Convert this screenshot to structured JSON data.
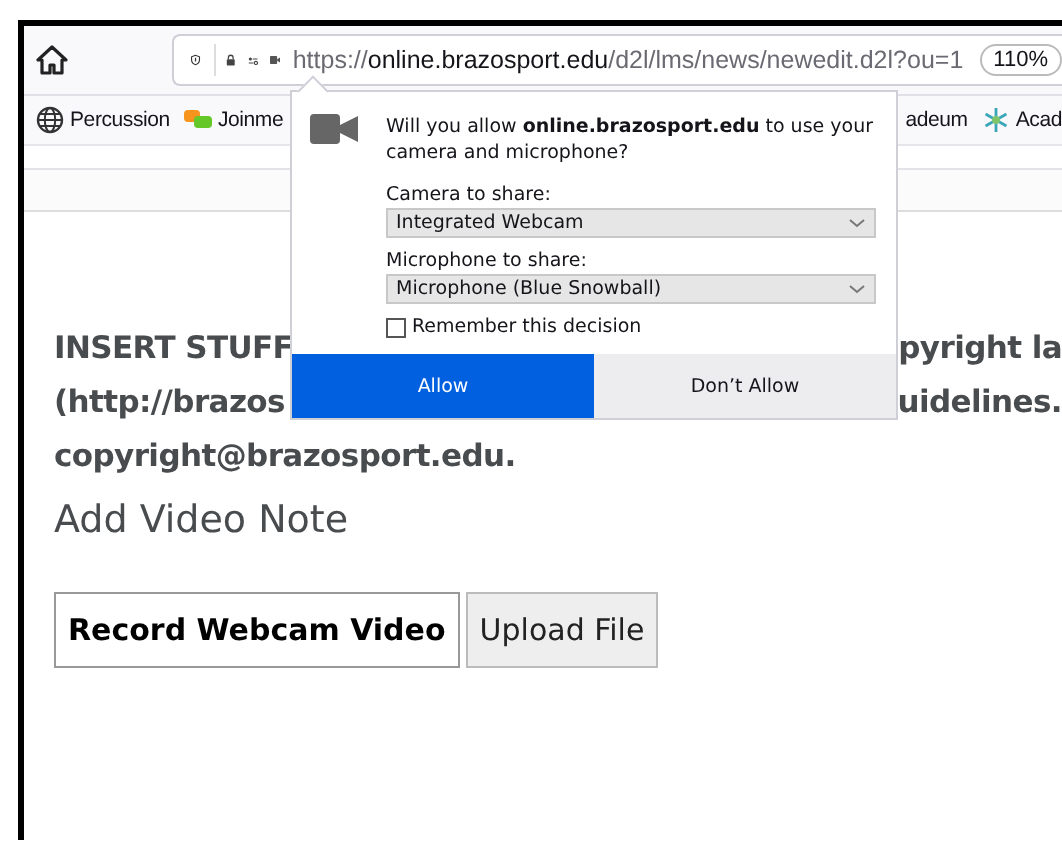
{
  "toolbar": {
    "url": {
      "scheme": "https://",
      "domain": "online.brazosport.edu",
      "path": "/d2l/lms/news/newedit.d2l?ou=1"
    },
    "zoom": "110%"
  },
  "bookmarks": [
    {
      "label": "Percussion",
      "kind": "globe"
    },
    {
      "label": "Joinme",
      "kind": "joinme"
    },
    {
      "label": "adeum",
      "kind": "plain"
    },
    {
      "label": "Acad",
      "kind": "academy"
    }
  ],
  "page": {
    "notice_lines": [
      {
        "left": "INSERT STUFF",
        "right": "pyright la"
      },
      {
        "left": "(http://brazos",
        "right": "uidelines."
      },
      {
        "left": "copyright@brazosport.edu."
      }
    ],
    "heading": "Add Video Note",
    "buttons": [
      {
        "label": "Record Webcam Video",
        "selected": true
      },
      {
        "label": "Upload File",
        "selected": false
      }
    ]
  },
  "permission_popup": {
    "message": "Will you allow **online.brazosport.edu** to use your camera and microphone?",
    "camera_label": "Camera to share:",
    "camera_choice": "Integrated Webcam",
    "microphone_label": "Microphone to share:",
    "microphone_choice": "Microphone (Blue Snowball)",
    "remember": {
      "label": "Remember this decision",
      "checked": false
    },
    "buttons": [
      {
        "label": "Allow",
        "selected": true
      },
      {
        "label": "Don’t Allow",
        "selected": false
      }
    ]
  }
}
